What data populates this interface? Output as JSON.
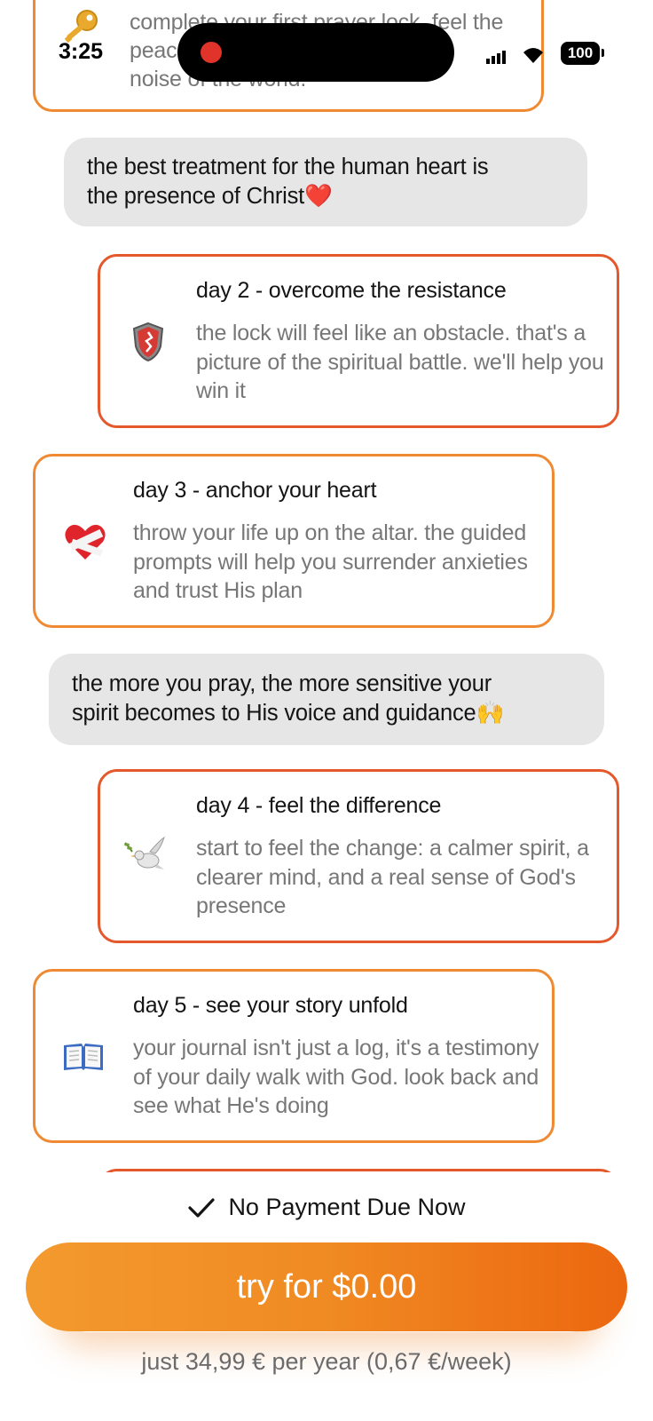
{
  "status_bar": {
    "time": "3:25",
    "battery": "100"
  },
  "cards": {
    "day1": {
      "text_line_1": "complete your first prayer lock. feel the",
      "text_line_2": "peace of stepping away for the",
      "text_line_3": "noise of the world."
    },
    "day2": {
      "title": "day 2 - overcome the resistance",
      "body": "the lock will feel like an obstacle. that's a picture of the spiritual battle. we'll help you win it",
      "icon": "shield-icon"
    },
    "day3": {
      "title": "day 3 - anchor your heart",
      "body": "throw your life up on the altar. the guided prompts will help you surrender anxieties and trust His plan",
      "icon": "bandaged-heart-icon"
    },
    "day4": {
      "title": "day 4 - feel the difference",
      "body": "start to feel the change: a calmer spirit, a clearer mind, and a real sense of God's presence",
      "icon": "dove-icon"
    },
    "day5": {
      "title": "day 5 - see your story unfold",
      "body": "your journal isn't just a log, it's a testimony of your daily walk with God. look back and see what He's doing",
      "icon": "open-book-icon"
    }
  },
  "quotes": {
    "q1": {
      "line_1": "the best treatment for the human heart is",
      "line_2": "the presence of Christ",
      "emoji": "❤️"
    },
    "q2": {
      "line_1": "the more you pray, the more sensitive your",
      "line_2": "spirit becomes to His voice and guidance",
      "emoji": "🙌"
    }
  },
  "footer": {
    "no_payment": "No Payment Due Now",
    "cta_label": "try for $0.00",
    "price_note": "just 34,99 € per year (0,67 €/week)"
  },
  "colors": {
    "accent_orange": "#ef8a33",
    "accent_red": "#e5582c",
    "quote_bg": "#e6e6e6",
    "cta_gradient_start": "#f39a2e",
    "cta_gradient_end": "#ec6710"
  }
}
